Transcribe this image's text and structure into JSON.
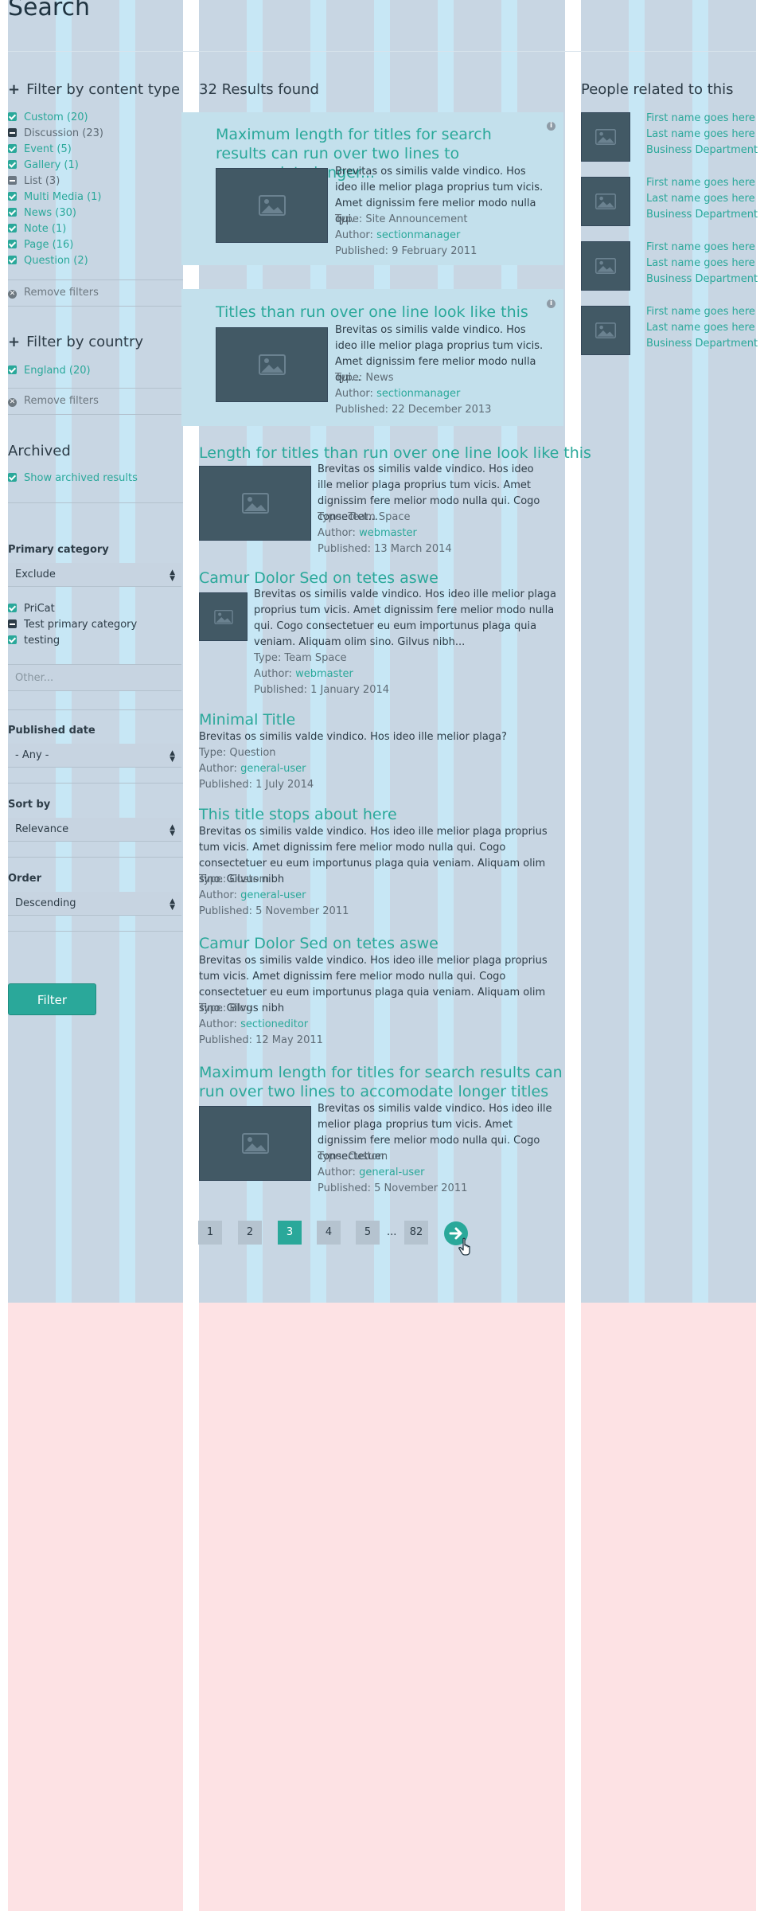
{
  "page": {
    "title": "Search"
  },
  "content_type_filter": {
    "heading": "Filter by content type",
    "items": [
      {
        "label": "Custom (20)",
        "state": "checked"
      },
      {
        "label": "Discussion (23)",
        "state": "mixed"
      },
      {
        "label": "Event (5)",
        "state": "checked"
      },
      {
        "label": "Gallery (1)",
        "state": "checked"
      },
      {
        "label": "List (3)",
        "state": "unchecked"
      },
      {
        "label": "Multi Media (1)",
        "state": "checked"
      },
      {
        "label": "News (30)",
        "state": "checked"
      },
      {
        "label": "Note (1)",
        "state": "checked"
      },
      {
        "label": "Page (16)",
        "state": "checked"
      },
      {
        "label": "Question (2)",
        "state": "checked"
      }
    ],
    "remove_label": "Remove filters"
  },
  "country_filter": {
    "heading": "Filter by country",
    "items": [
      {
        "label": "England (20)",
        "state": "checked"
      }
    ],
    "remove_label": "Remove filters"
  },
  "archived": {
    "heading": "Archived",
    "checkbox_label": "Show archived results"
  },
  "primary_category": {
    "heading": "Primary category",
    "select_value": "Exclude",
    "items": [
      {
        "label": "PriCat",
        "state": "checked"
      },
      {
        "label": "Test primary category",
        "state": "mixed"
      },
      {
        "label": "testing",
        "state": "checked"
      }
    ],
    "other_placeholder": "Other..."
  },
  "published_date": {
    "heading": "Published date",
    "select_value": "- Any -"
  },
  "sort_by": {
    "heading": "Sort by",
    "select_value": "Relevance"
  },
  "order": {
    "heading": "Order",
    "select_value": "Descending"
  },
  "filter_button": "Filter",
  "results": {
    "heading": "32 Results found",
    "labels": {
      "type": "Type:",
      "author": "Author:",
      "published": "Published:"
    },
    "items": [
      {
        "title": "Maximum length for titles for search results can run over two lines to accomodate longer...",
        "snippet": "Brevitas os similis valde vindico. Hos ideo ille melior plaga proprius tum vicis. Amet dignissim fere melior modo nulla qui.",
        "type": "Site Announcement",
        "author": "sectionmanager",
        "published": "9 February 2011",
        "highlighted": true
      },
      {
        "title": "Titles than run over one line look like this one",
        "snippet": "Brevitas os similis valde vindico. Hos ideo ille melior plaga proprius tum vicis. Amet dignissim fere melior modo nulla qui...",
        "type": "News",
        "author": "sectionmanager",
        "published": "22 December 2013",
        "highlighted": true
      },
      {
        "title": "Length for titles than run over one line look like this",
        "snippet": "Brevitas os similis valde vindico. Hos ideo ille melior plaga proprius tum vicis. Amet dignissim fere melior modo nulla qui. Cogo consectet...",
        "type": "Team Space",
        "author": "webmaster",
        "published": "13 March 2014"
      },
      {
        "title": "Camur Dolor Sed on tetes aswe",
        "snippet": "Brevitas os similis valde vindico. Hos ideo ille melior plaga proprius tum vicis. Amet dignissim fere melior modo nulla qui. Cogo consectetuer eu eum importunus plaga quia veniam. Aliquam olim sino. Gilvus nibh...",
        "type": "Team Space",
        "author": "webmaster",
        "published": "1 January 2014"
      },
      {
        "title": "Minimal Title",
        "snippet": "Brevitas os similis valde vindico. Hos ideo ille melior plaga?",
        "type": "Question",
        "author": "general-user",
        "published": "1 July 2014"
      },
      {
        "title": "This title stops about here",
        "snippet": "Brevitas os similis valde vindico. Hos ideo ille melior plaga proprius tum vicis. Amet dignissim fere melior modo nulla qui. Cogo consectetuer eu eum importunus plaga quia veniam. Aliquam olim sino. Gilvus nibh",
        "type": "Custom",
        "author": "general-user",
        "published": "5 November 2011"
      },
      {
        "title": "Camur Dolor Sed on tetes aswe",
        "snippet": "Brevitas os similis valde vindico. Hos ideo ille melior plaga proprius tum vicis. Amet dignissim fere melior modo nulla qui. Cogo consectetuer eu eum importunus plaga quia veniam. Aliquam olim sino. Gilvus nibh",
        "type": "Blog",
        "author": "sectioneditor",
        "published": "12 May 2011"
      },
      {
        "title": "Maximum length for titles for search results can run over two lines to accomodate longer titles",
        "snippet": "Brevitas os similis valde vindico. Hos ideo ille melior plaga proprius tum vicis. Amet dignissim fere melior modo nulla qui. Cogo consectetuer",
        "type": "Custom",
        "author": "general-user",
        "published": "5 November 2011"
      }
    ]
  },
  "pagination": {
    "pages": [
      "1",
      "2",
      "3",
      "4",
      "5"
    ],
    "current": "3",
    "ellipsis": "...",
    "last": "82"
  },
  "people": {
    "heading": "People related to this",
    "items": [
      {
        "first": "First name goes here",
        "last": "Last name goes here",
        "dept": "Business Department"
      },
      {
        "first": "First name goes here",
        "last": "Last name goes here",
        "dept": "Business Department"
      },
      {
        "first": "First name goes here",
        "last": "Last name goes here",
        "dept": "Business Department"
      },
      {
        "first": "First name goes here",
        "last": "Last name goes here",
        "dept": "Business Department"
      }
    ]
  },
  "colors": {
    "accent": "#2aa89a",
    "grid_column": "#c8d6e3",
    "grid_gutter": "#c7e7f5",
    "grid_lower": "#fde2e4",
    "thumbnail": "#425965"
  }
}
